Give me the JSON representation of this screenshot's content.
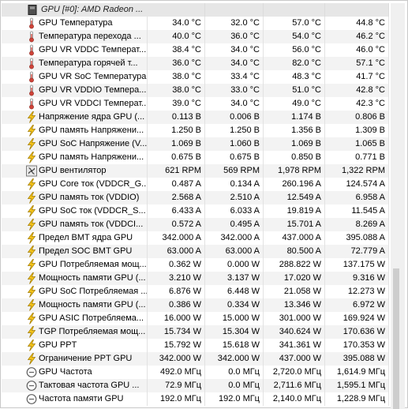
{
  "window": {
    "group_header": "GPU [#0]: AMD Radeon ..."
  },
  "sensors": [
    {
      "type": "temp",
      "name": "GPU Температура",
      "v": [
        "34.0 °C",
        "32.0 °C",
        "57.0 °C",
        "44.8 °C"
      ]
    },
    {
      "type": "temp",
      "name": "Температура перехода ...",
      "v": [
        "40.0 °C",
        "36.0 °C",
        "54.0 °C",
        "46.2 °C"
      ]
    },
    {
      "type": "temp",
      "name": "GPU VR VDDC Температ...",
      "v": [
        "38.4 °C",
        "34.0 °C",
        "56.0 °C",
        "46.0 °C"
      ]
    },
    {
      "type": "temp",
      "name": "Температура горячей т...",
      "v": [
        "36.0 °C",
        "34.0 °C",
        "82.0 °C",
        "57.1 °C"
      ]
    },
    {
      "type": "temp",
      "name": "GPU VR SoC Температура",
      "v": [
        "38.0 °C",
        "33.4 °C",
        "48.3 °C",
        "41.7 °C"
      ]
    },
    {
      "type": "temp",
      "name": "GPU VR VDDIO Темпера...",
      "v": [
        "38.0 °C",
        "33.0 °C",
        "51.0 °C",
        "42.8 °C"
      ]
    },
    {
      "type": "temp",
      "name": "GPU VR VDDCI Температ...",
      "v": [
        "39.0 °C",
        "34.0 °C",
        "49.0 °C",
        "42.3 °C"
      ]
    },
    {
      "type": "volt",
      "name": "Напряжение ядра GPU (...",
      "v": [
        "0.113 В",
        "0.006 В",
        "1.174 В",
        "0.806 В"
      ]
    },
    {
      "type": "volt",
      "name": "GPU память Напряжени...",
      "v": [
        "1.250 В",
        "1.250 В",
        "1.356 В",
        "1.309 В"
      ]
    },
    {
      "type": "volt",
      "name": "GPU SoC Напряжение (V...",
      "v": [
        "1.069 В",
        "1.060 В",
        "1.069 В",
        "1.065 В"
      ]
    },
    {
      "type": "volt",
      "name": "GPU память Напряжени...",
      "v": [
        "0.675 В",
        "0.675 В",
        "0.850 В",
        "0.771 В"
      ]
    },
    {
      "type": "fan",
      "name": "GPU вентилятор",
      "v": [
        "621 RPM",
        "569 RPM",
        "1,978 RPM",
        "1,322 RPM"
      ]
    },
    {
      "type": "volt",
      "name": "GPU Core ток (VDDCR_G...",
      "v": [
        "0.487 A",
        "0.134 A",
        "260.196 A",
        "124.574 A"
      ]
    },
    {
      "type": "volt",
      "name": "GPU память ток (VDDIO)",
      "v": [
        "2.568 A",
        "2.510 A",
        "12.549 A",
        "6.958 A"
      ]
    },
    {
      "type": "volt",
      "name": "GPU SoC ток (VDDCR_S...",
      "v": [
        "6.433 A",
        "6.033 A",
        "19.819 A",
        "11.545 A"
      ]
    },
    {
      "type": "volt",
      "name": "GPU память ток (VDDCI...",
      "v": [
        "0.572 A",
        "0.495 A",
        "15.701 A",
        "8.269 A"
      ]
    },
    {
      "type": "volt",
      "name": "Предел BMT ядра GPU",
      "v": [
        "342.000 A",
        "342.000 A",
        "437.000 A",
        "395.088 A"
      ]
    },
    {
      "type": "volt",
      "name": "Предел SOC BMT GPU",
      "v": [
        "63.000 A",
        "63.000 A",
        "80.500 A",
        "72.779 A"
      ]
    },
    {
      "type": "volt",
      "name": "GPU Потребляемая мощ...",
      "v": [
        "0.362 W",
        "0.000 W",
        "288.822 W",
        "137.175 W"
      ]
    },
    {
      "type": "volt",
      "name": "Мощность памяти GPU (...",
      "v": [
        "3.210 W",
        "3.137 W",
        "17.020 W",
        "9.316 W"
      ]
    },
    {
      "type": "volt",
      "name": "GPU SoC Потребляемая ...",
      "v": [
        "6.876 W",
        "6.448 W",
        "21.058 W",
        "12.273 W"
      ]
    },
    {
      "type": "volt",
      "name": "Мощность памяти GPU (...",
      "v": [
        "0.386 W",
        "0.334 W",
        "13.346 W",
        "6.972 W"
      ]
    },
    {
      "type": "volt",
      "name": "GPU ASIC Потребляема...",
      "v": [
        "16.000 W",
        "15.000 W",
        "301.000 W",
        "169.924 W"
      ]
    },
    {
      "type": "volt",
      "name": "TGP Потребляемая мощ...",
      "v": [
        "15.734 W",
        "15.304 W",
        "340.624 W",
        "170.636 W"
      ]
    },
    {
      "type": "volt",
      "name": "GPU PPT",
      "v": [
        "15.792 W",
        "15.618 W",
        "341.361 W",
        "170.353 W"
      ]
    },
    {
      "type": "volt",
      "name": "Ограничение PPT GPU",
      "v": [
        "342.000 W",
        "342.000 W",
        "437.000 W",
        "395.088 W"
      ]
    },
    {
      "type": "clock",
      "name": "GPU Частота",
      "v": [
        "492.0 МГц",
        "0.0 МГц",
        "2,720.0 МГц",
        "1,614.9 МГц"
      ]
    },
    {
      "type": "clock",
      "name": "Тактовая частота GPU ...",
      "v": [
        "72.9 МГц",
        "0.0 МГц",
        "2,711.6 МГц",
        "1,595.1 МГц"
      ]
    },
    {
      "type": "clock",
      "name": "Частота памяти GPU",
      "v": [
        "192.0 МГц",
        "192.0 МГц",
        "2,140.0 МГц",
        "1,228.9 МГц"
      ]
    }
  ],
  "icons": {
    "temp": "thermometer-icon",
    "volt": "lightning-icon",
    "fan": "fan-icon",
    "clock": "clock-icon",
    "group": "gpu-card-icon"
  },
  "colors": {
    "thermometer": "#d0443a",
    "lightning": "#f2c21b",
    "lightning_outline": "#a07a00",
    "clock": "#606060",
    "fan": "#404040"
  }
}
